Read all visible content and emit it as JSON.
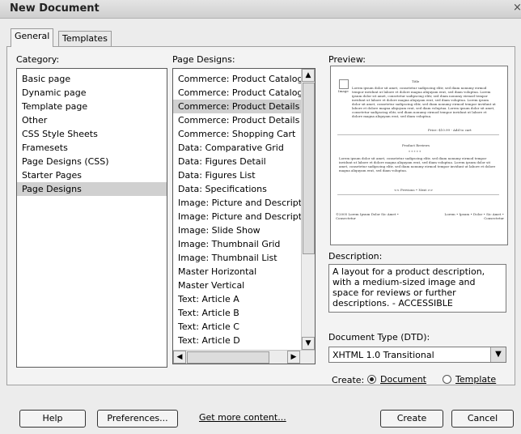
{
  "window": {
    "title": "New Document",
    "close_glyph": "×"
  },
  "tabs": [
    "General",
    "Templates"
  ],
  "labels": {
    "category": "Category:",
    "page_designs": "Page Designs:",
    "preview": "Preview:",
    "description": "Description:",
    "doctype": "Document Type (DTD):",
    "create": "Create:"
  },
  "categories": [
    "Basic page",
    "Dynamic page",
    "Template page",
    "Other",
    "CSS Style Sheets",
    "Framesets",
    "Page Designs (CSS)",
    "Starter Pages",
    "Page Designs"
  ],
  "selected_category": "Page Designs",
  "page_designs": [
    "Commerce: Product Catalog",
    "Commerce: Product Catalog",
    "Commerce: Product Details",
    "Commerce: Product Details",
    "Commerce: Shopping Cart",
    "Data: Comparative Grid",
    "Data: Figures Detail",
    "Data: Figures List",
    "Data: Specifications",
    "Image: Picture and Description",
    "Image: Picture and Description",
    "Image: Slide Show",
    "Image: Thumbnail Grid",
    "Image: Thumbnail List",
    "Master Horizontal",
    "Master Vertical",
    "Text: Article A",
    "Text: Article B",
    "Text: Article C",
    "Text: Article D"
  ],
  "selected_design_index": 2,
  "preview": {
    "img_label": "Image",
    "title": "Title",
    "body": "Lorem ipsum dolor sit amet, consetetur sadipscing elitr, sed diam nonumy eirmod tempor invidunt ut labore et dolore magna aliquyam erat, sed diam voluptua. Lorem ipsum dolor sit amet, consetetur sadipscing elitr, sed diam nonumy eirmod tempor invidunt ut labore et dolore magna aliquyam erat, sed diam voluptua. Lorem ipsum dolor sit amet, consetetur sadipscing elitr, sed diam nonumy eirmod tempor invidunt ut labore et dolore magna aliquyam erat, sed diam voluptua. Lorem ipsum dolor sit amet, consetetur sadipscing elitr, sed diam nonumy eirmod tempor invidunt ut labore et dolore magna aliquyam erat, sed diam voluptua.",
    "price": "Price: $10.99 - Add to cart",
    "reviews_title": "Product Reviews",
    "stars": "* * * * *",
    "reviews_body": "Lorem ipsum dolor sit amet, consetetur sadipscing elitr, sed diam nonumy eirmod tempor invidunt ut labore et dolore magna aliquyam erat, sed diam voluptua. Lorem ipsum dolor sit amet, consetetur sadipscing elitr, sed diam nonumy eirmod tempor invidunt ut labore et dolore magna aliquyam erat, sed diam voluptua.",
    "pager": "<< Previous • Next >>",
    "footer_left": "©2005 Lorem Ipsum Dolor Sic Amet • Consectetur",
    "footer_right": "Lorem • Ipsum • Dolor • Sic Amet • Consectetur"
  },
  "description": "A layout for a product description, with a medium-sized image and space for reviews or further descriptions. - ACCESSIBLE",
  "doctype": {
    "value": "XHTML 1.0 Transitional"
  },
  "create_options": [
    {
      "label": "Document",
      "checked": true
    },
    {
      "label": "Template",
      "checked": false
    }
  ],
  "buttons": {
    "help": "Help",
    "preferences": "Preferences...",
    "get_more": "Get more content...",
    "create": "Create",
    "cancel": "Cancel"
  }
}
